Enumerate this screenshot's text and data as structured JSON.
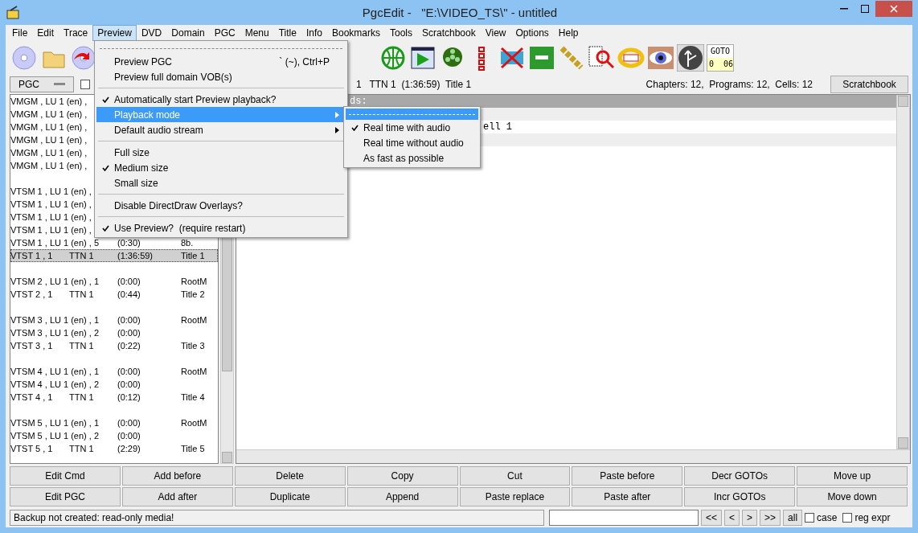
{
  "window": {
    "title": "PgcEdit -   \"E:\\VIDEO_TS\\\" - untitled"
  },
  "menu_bar": [
    {
      "label": "File",
      "selected": false
    },
    {
      "label": "Edit",
      "selected": false
    },
    {
      "label": "Trace",
      "selected": false
    },
    {
      "label": "Preview",
      "selected": true
    },
    {
      "label": "DVD",
      "selected": false
    },
    {
      "label": "Domain",
      "selected": false
    },
    {
      "label": "PGC",
      "selected": false
    },
    {
      "label": "Menu",
      "selected": false
    },
    {
      "label": "Title",
      "selected": false
    },
    {
      "label": "Info",
      "selected": false
    },
    {
      "label": "Bookmarks",
      "selected": false
    },
    {
      "label": "Tools",
      "selected": false
    },
    {
      "label": "Scratchbook",
      "selected": false
    },
    {
      "label": "View",
      "selected": false
    },
    {
      "label": "Options",
      "selected": false
    },
    {
      "label": "Help",
      "selected": false
    }
  ],
  "preview_menu": [
    {
      "kind": "tearoff",
      "selected": false
    },
    {
      "kind": "item",
      "label": "Preview PGC",
      "shortcut": "` (~), Ctrl+P",
      "checked": false,
      "selected": false
    },
    {
      "kind": "item",
      "label": "Preview full domain VOB(s)",
      "checked": false,
      "selected": false
    },
    {
      "kind": "separator"
    },
    {
      "kind": "item",
      "label": "Automatically start Preview playback?",
      "checked": true,
      "selected": false
    },
    {
      "kind": "submenu",
      "label": "Playback mode",
      "checked": false,
      "selected": true
    },
    {
      "kind": "submenu",
      "label": "Default audio stream",
      "checked": false,
      "selected": false
    },
    {
      "kind": "separator"
    },
    {
      "kind": "item",
      "label": "Full size",
      "checked": false,
      "selected": false
    },
    {
      "kind": "item",
      "label": "Medium size",
      "checked": true,
      "selected": false
    },
    {
      "kind": "item",
      "label": "Small size",
      "checked": false,
      "selected": false
    },
    {
      "kind": "separator"
    },
    {
      "kind": "item",
      "label": "Disable DirectDraw Overlays?",
      "checked": false,
      "selected": false
    },
    {
      "kind": "separator"
    },
    {
      "kind": "item",
      "label": "Use Preview?  (require restart)",
      "checked": true,
      "selected": false
    }
  ],
  "playback_submenu": [
    {
      "kind": "tearoff",
      "selected": true
    },
    {
      "kind": "item",
      "label": "Real time with audio",
      "checked": true,
      "selected": false
    },
    {
      "kind": "item",
      "label": "Real time without audio",
      "checked": false,
      "selected": false
    },
    {
      "kind": "item",
      "label": "As fast as possible",
      "checked": false,
      "selected": false
    }
  ],
  "goto_counter": {
    "label": "GOTO",
    "value": "0  06"
  },
  "info_bar": {
    "mode": "PGC",
    "checked": false,
    "current": "1   TTN 1  (1:36:59)  Title 1",
    "counts": "Chapters: 12,  Programs: 12,  Cells: 12",
    "button": "Scratchbook"
  },
  "pgc_list": [
    {
      "kind": "entry",
      "cells": [
        "VMGM , LU 1 (en) ,"
      ],
      "selected": false
    },
    {
      "kind": "entry",
      "cells": [
        "VMGM , LU 1 (en) ,"
      ],
      "selected": false
    },
    {
      "kind": "entry",
      "cells": [
        "VMGM , LU 1 (en) ,"
      ],
      "selected": false
    },
    {
      "kind": "entry",
      "cells": [
        "VMGM , LU 1 (en) ,"
      ],
      "selected": false
    },
    {
      "kind": "entry",
      "cells": [
        "VMGM , LU 1 (en) ,"
      ],
      "selected": false
    },
    {
      "kind": "entry",
      "cells": [
        "VMGM , LU 1 (en) ,"
      ],
      "selected": false
    },
    {
      "kind": "gap"
    },
    {
      "kind": "entry",
      "cells": [
        "VTSM 1 , LU 1 (en) ,"
      ],
      "selected": false
    },
    {
      "kind": "entry",
      "cells": [
        "VTSM 1 , LU 1 (en) ,"
      ],
      "selected": false
    },
    {
      "kind": "entry",
      "cells": [
        "VTSM 1 , LU 1 (en) ,"
      ],
      "selected": false
    },
    {
      "kind": "entry",
      "cells": [
        "VTSM 1 , LU 1 (en) ,"
      ],
      "selected": false
    },
    {
      "kind": "entry",
      "cells": [
        "VTSM 1 , LU 1 (en) , 5",
        "",
        "(0:30)",
        "8b."
      ],
      "selected": false
    },
    {
      "kind": "entry",
      "cells": [
        "VTST 1 , 1",
        "TTN 1",
        "(1:36:59)",
        "Title 1"
      ],
      "selected": true
    },
    {
      "kind": "gap"
    },
    {
      "kind": "entry",
      "cells": [
        "VTSM 2 , LU 1 (en) , 1",
        "",
        "(0:00)",
        "RootM"
      ],
      "selected": false
    },
    {
      "kind": "entry",
      "cells": [
        "VTST 2 , 1",
        "TTN 1",
        "(0:44)",
        "Title 2"
      ],
      "selected": false
    },
    {
      "kind": "gap"
    },
    {
      "kind": "entry",
      "cells": [
        "VTSM 3 , LU 1 (en) , 1",
        "",
        "(0:00)",
        "RootM"
      ],
      "selected": false
    },
    {
      "kind": "entry",
      "cells": [
        "VTSM 3 , LU 1 (en) , 2",
        "",
        "(0:00)"
      ],
      "selected": false
    },
    {
      "kind": "entry",
      "cells": [
        "VTST 3 , 1",
        "TTN 1",
        "(0:22)",
        "Title 3"
      ],
      "selected": false
    },
    {
      "kind": "gap"
    },
    {
      "kind": "entry",
      "cells": [
        "VTSM 4 , LU 1 (en) , 1",
        "",
        "(0:00)",
        "RootM"
      ],
      "selected": false
    },
    {
      "kind": "entry",
      "cells": [
        "VTSM 4 , LU 1 (en) , 2",
        "",
        "(0:00)"
      ],
      "selected": false
    },
    {
      "kind": "entry",
      "cells": [
        "VTST 4 , 1",
        "TTN 1",
        "(0:12)",
        "Title 4"
      ],
      "selected": false
    },
    {
      "kind": "gap"
    },
    {
      "kind": "entry",
      "cells": [
        "VTSM 5 , LU 1 (en) , 1",
        "",
        "(0:00)",
        "RootM"
      ],
      "selected": false
    },
    {
      "kind": "entry",
      "cells": [
        "VTSM 5 , LU 1 (en) , 2",
        "",
        "(0:00)"
      ],
      "selected": false
    },
    {
      "kind": "entry",
      "cells": [
        "VTST 5 , 1",
        "TTN 1",
        "(2:29)",
        "Title 5"
      ],
      "selected": false
    }
  ],
  "editor_lines": [
    {
      "kind": "header",
      "text": "ds:"
    },
    {
      "kind": "plain"
    },
    {
      "kind": "cell",
      "text": "ell 1"
    },
    {
      "kind": "plain"
    }
  ],
  "buttons": [
    [
      "Edit Cmd",
      "Add before",
      "Delete",
      "Copy",
      "Cut",
      "Paste before",
      "Decr GOTOs",
      "Move up"
    ],
    [
      "Edit PGC",
      "Add after",
      "Duplicate",
      "Append",
      "Paste replace",
      "Paste after",
      "Incr GOTOs",
      "Move down"
    ]
  ],
  "status_bar": {
    "message": "Backup not created: read-only media!",
    "nav": [
      "<<",
      "<",
      ">",
      ">>",
      "all"
    ],
    "options": [
      {
        "label": "case",
        "checked": false
      },
      {
        "label": "reg expr",
        "checked": false
      }
    ]
  }
}
